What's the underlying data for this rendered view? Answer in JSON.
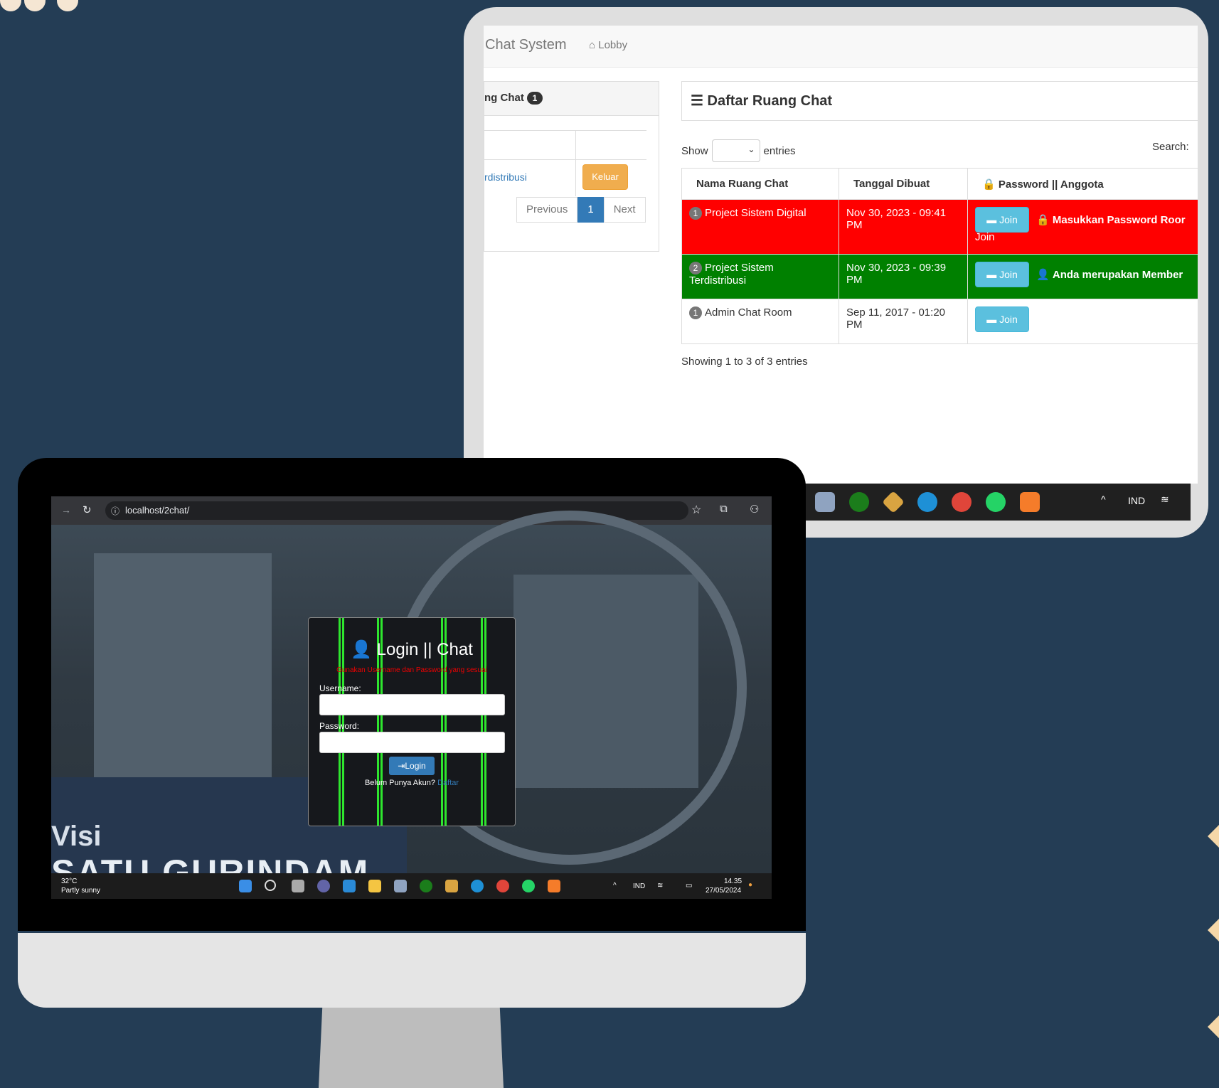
{
  "tablet": {
    "brand": "Chat System",
    "nav_lobby": "Lobby",
    "left_panel": {
      "title": "ng Chat",
      "badge": "1",
      "room_link": "rdistribusi",
      "leave_button": "Keluar",
      "pager": {
        "previous": "Previous",
        "page": "1",
        "next": "Next"
      }
    },
    "rooms_panel": {
      "title": "Daftar Ruang Chat",
      "show_label": "Show",
      "entries_label": "entries",
      "search_label": "Search:",
      "columns": [
        "Nama Ruang Chat",
        "Tanggal Dibuat",
        "Password || Anggota"
      ],
      "rows": [
        {
          "badge": "1",
          "name": "Project Sistem Digital",
          "date": "Nov 30, 2023 - 09:41 PM",
          "join": "Join",
          "status": "Masukkan Password Roor",
          "status_extra": "Join"
        },
        {
          "badge": "2",
          "name": "Project Sistem Terdistribusi",
          "date": "Nov 30, 2023 - 09:39 PM",
          "join": "Join",
          "status": "Anda merupakan Member",
          "status_extra": ""
        },
        {
          "badge": "1",
          "name": "Admin Chat Room",
          "date": "Sep 11, 2017 - 01:20 PM",
          "join": "Join",
          "status": "",
          "status_extra": ""
        }
      ],
      "showing": "Showing 1 to 3 of 3 entries"
    },
    "taskbar": {
      "lang": "IND"
    }
  },
  "monitor": {
    "url": "localhost/2chat/",
    "banner_visi": "Visi",
    "banner_title": "SATU GURINDAM",
    "login": {
      "title": "Login || Chat",
      "warning": "Gunakan Username dan Password yang sesuai",
      "username_label": "Username:",
      "password_label": "Password:",
      "button": "Login",
      "register_text": "Belum Punya Akun?",
      "register_link": "Daftar"
    },
    "taskbar": {
      "weather_temp": "32°C",
      "weather_desc": "Partly sunny",
      "lang": "IND",
      "time": "14.35",
      "date": "27/05/2024"
    }
  },
  "colors": {
    "background": "#243d55",
    "row_red": "#ff0000",
    "row_green": "#008000",
    "join_button": "#5bc0de",
    "leave_button": "#f0ad4e",
    "neon_green": "#2ee52e"
  }
}
